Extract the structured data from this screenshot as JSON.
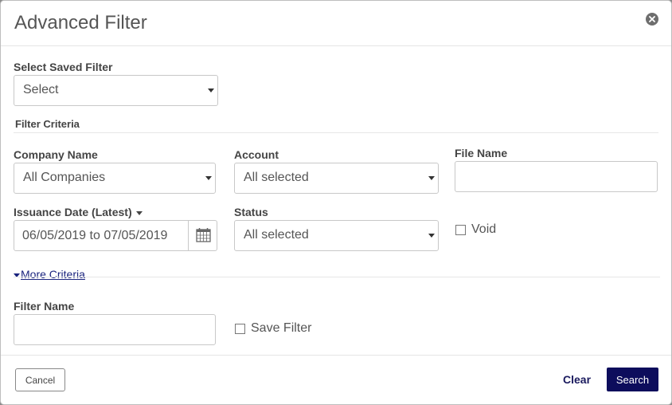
{
  "modal": {
    "title": "Advanced Filter"
  },
  "saved_filter": {
    "label": "Select Saved Filter",
    "value": "Select"
  },
  "section": {
    "criteria_title": "Filter Criteria"
  },
  "company": {
    "label": "Company Name",
    "value": "All Companies"
  },
  "account": {
    "label": "Account",
    "value": "All selected"
  },
  "file_name": {
    "label": "File Name",
    "value": ""
  },
  "issuance": {
    "label": "Issuance Date (Latest)",
    "value": "06/05/2019 to 07/05/2019"
  },
  "status": {
    "label": "Status",
    "value": "All selected"
  },
  "void": {
    "label": "Void",
    "checked": false
  },
  "more_criteria": {
    "label": "More Criteria"
  },
  "filter_name": {
    "label": "Filter Name",
    "value": ""
  },
  "save_filter": {
    "label": "Save Filter",
    "checked": false
  },
  "footer": {
    "cancel": "Cancel",
    "clear": "Clear",
    "search": "Search"
  },
  "colors": {
    "primary": "#0d0d5c",
    "link": "#1a237e",
    "text": "#555555"
  },
  "icons": {
    "close": "close-icon",
    "calendar": "calendar-icon"
  }
}
